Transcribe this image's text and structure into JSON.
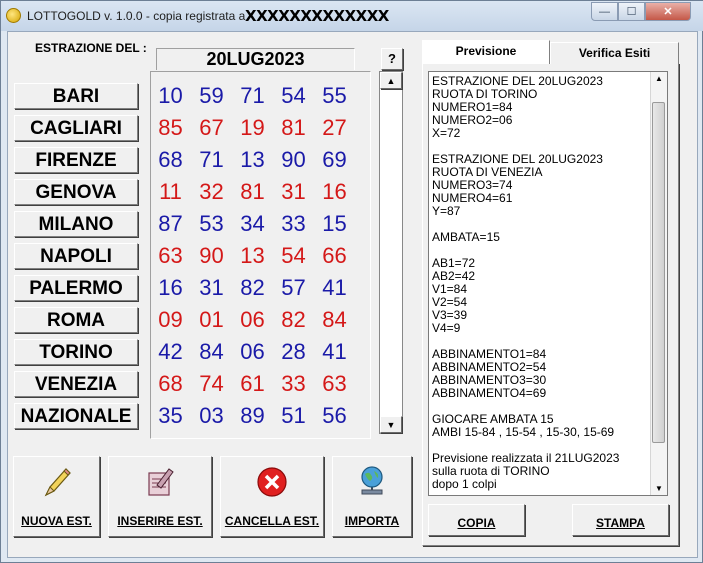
{
  "window": {
    "title": "LOTTOGOLD v. 1.0.0 - copia registrata a ",
    "registered_to": "XXXXXXXXXXXXX",
    "controls": {
      "minimize": "—",
      "maximize": "☐",
      "close": "✕"
    }
  },
  "extraction": {
    "label": "ESTRAZIONE DEL :",
    "date": "20LUG2023",
    "help_label": "?"
  },
  "wheels": [
    {
      "city": "BARI",
      "numbers": [
        "10",
        "59",
        "71",
        "54",
        "55"
      ],
      "color": "#1a1aa8"
    },
    {
      "city": "CAGLIARI",
      "numbers": [
        "85",
        "67",
        "19",
        "81",
        "27"
      ],
      "color": "#d41818"
    },
    {
      "city": "FIRENZE",
      "numbers": [
        "68",
        "71",
        "13",
        "90",
        "69"
      ],
      "color": "#1a1aa8"
    },
    {
      "city": "GENOVA",
      "numbers": [
        "11",
        "32",
        "81",
        "31",
        "16"
      ],
      "color": "#d41818"
    },
    {
      "city": "MILANO",
      "numbers": [
        "87",
        "53",
        "34",
        "33",
        "15"
      ],
      "color": "#1a1aa8"
    },
    {
      "city": "NAPOLI",
      "numbers": [
        "63",
        "90",
        "13",
        "54",
        "66"
      ],
      "color": "#d41818"
    },
    {
      "city": "PALERMO",
      "numbers": [
        "16",
        "31",
        "82",
        "57",
        "41"
      ],
      "color": "#1a1aa8"
    },
    {
      "city": "ROMA",
      "numbers": [
        "09",
        "01",
        "06",
        "82",
        "84"
      ],
      "color": "#d41818"
    },
    {
      "city": "TORINO",
      "numbers": [
        "42",
        "84",
        "06",
        "28",
        "41"
      ],
      "color": "#1a1aa8"
    },
    {
      "city": "VENEZIA",
      "numbers": [
        "68",
        "74",
        "61",
        "33",
        "63"
      ],
      "color": "#d41818"
    },
    {
      "city": "NAZIONALE",
      "numbers": [
        "35",
        "03",
        "89",
        "51",
        "56"
      ],
      "color": "#1a1aa8"
    }
  ],
  "actions": [
    {
      "label": "NUOVA EST.",
      "icon": "pencil-icon"
    },
    {
      "label": "INSERIRE EST.",
      "icon": "notebook-edit-icon"
    },
    {
      "label": "CANCELLA EST.",
      "icon": "delete-icon"
    },
    {
      "label": "IMPORTA",
      "icon": "globe-import-icon"
    }
  ],
  "tabs": {
    "previsione": "Previsione",
    "verifica": "Verifica Esiti"
  },
  "memo": "ESTRAZIONE DEL 20LUG2023\nRUOTA DI TORINO\nNUMERO1=84\nNUMERO2=06\nX=72\n\nESTRAZIONE DEL 20LUG2023\nRUOTA DI VENEZIA\nNUMERO3=74\nNUMERO4=61\nY=87\n\nAMBATA=15\n\nAB1=72\nAB2=42\nV1=84\nV2=54\nV3=39\nV4=9\n\nABBINAMENTO1=84\nABBINAMENTO2=54\nABBINAMENTO3=30\nABBINAMENTO4=69\n\nGIOCARE AMBATA 15\nAMBI 15-84 , 15-54 , 15-30, 15-69\n\nPrevisione realizzata il 21LUG2023\nsulla ruota di TORINO\ndopo 1 colpi",
  "panel_buttons": {
    "copy": "COPIA",
    "print": "STAMPA"
  }
}
